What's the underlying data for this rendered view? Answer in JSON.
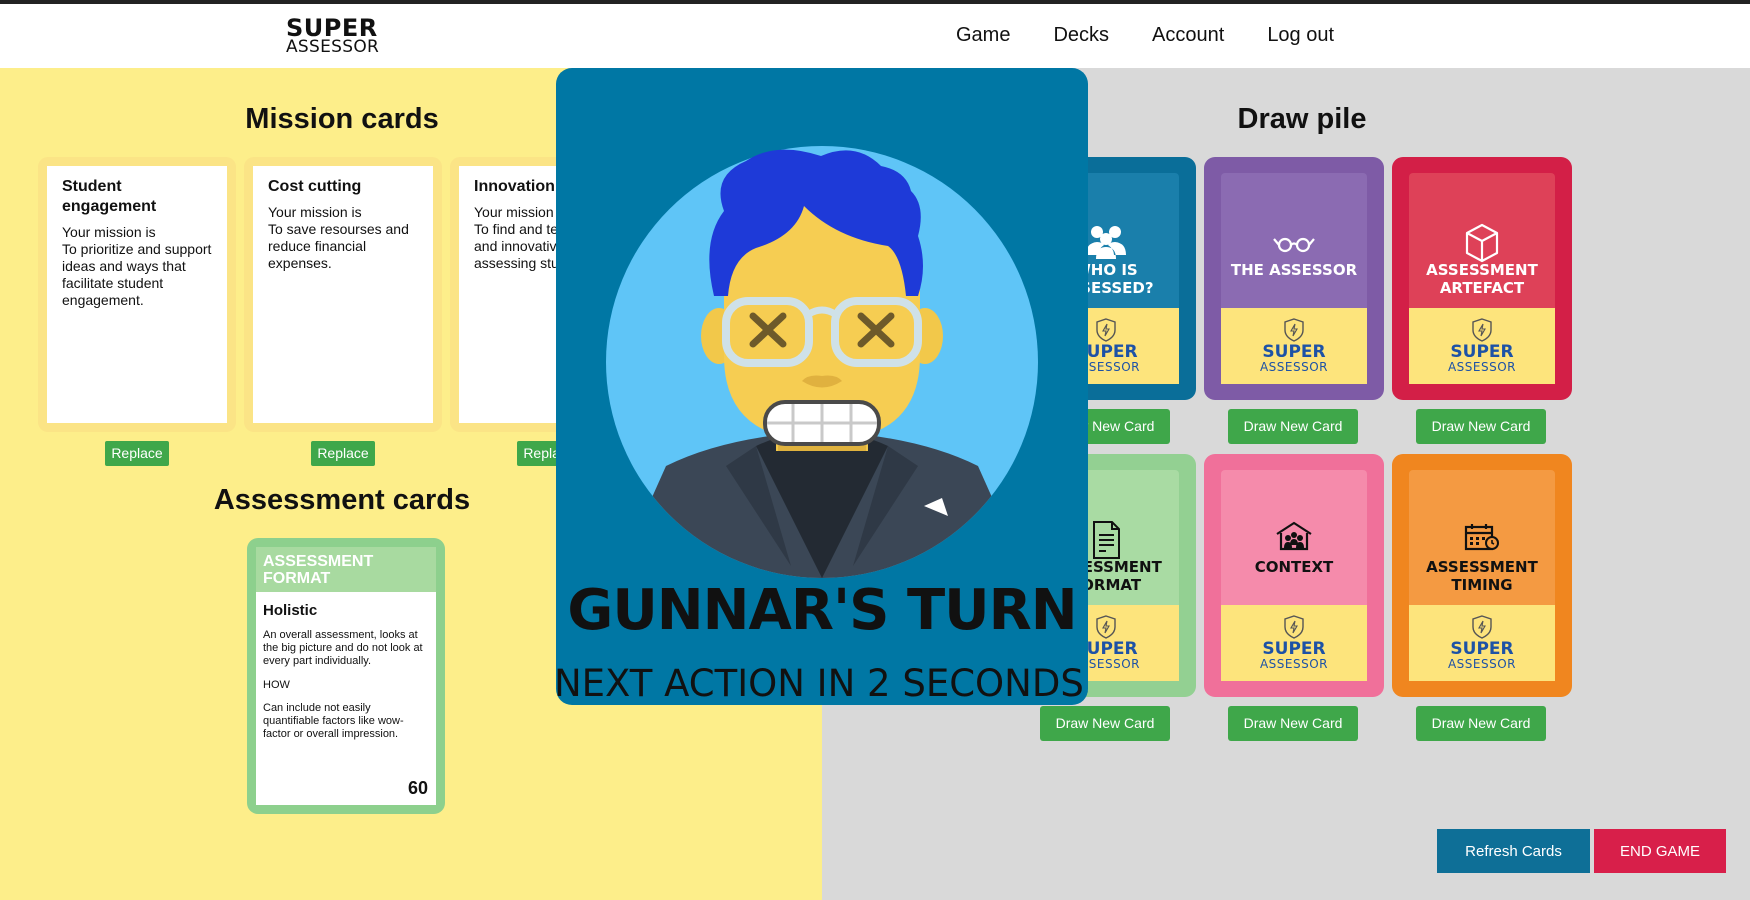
{
  "header": {
    "logo_line1": "SUPER",
    "logo_line2": "ASSESSOR",
    "nav": [
      "Game",
      "Decks",
      "Account",
      "Log out"
    ]
  },
  "mission": {
    "title": "Mission cards",
    "cards": [
      {
        "title": "Student engagement",
        "text": "Your mission is\nTo prioritize and support ideas and ways that facilitate student engagement."
      },
      {
        "title": "Cost cutting",
        "text": "Your mission is\nTo save resourses and reduce financial expenses."
      },
      {
        "title": "Innovation",
        "text": "Your mission is\nTo find and test new and innovative ways of assessing students."
      }
    ],
    "replace_label": "Replace"
  },
  "assessment": {
    "title": "Assessment cards",
    "card": {
      "category": "ASSESSMENT FORMAT",
      "title": "Holistic",
      "description": "An overall assessment, looks at the big picture and do not look at every part individually.",
      "how": "HOW",
      "note": "Can include not easily quantifiable factors like wow-factor or overall impression.",
      "points": "60"
    }
  },
  "draw_pile": {
    "title": "Draw pile",
    "draw_label": "Draw New Card",
    "brand_line1": "SUPER",
    "brand_line2": "ASSESSOR",
    "decks": [
      {
        "title": "WHO IS ASSESSED?",
        "icon": "group-icon",
        "outer": "#0a6e99",
        "inner": "#1a7fab",
        "text_color": "#ffffff"
      },
      {
        "title": "THE ASSESSOR",
        "icon": "glasses-icon",
        "outer": "#7e5ba6",
        "inner": "#8b6bb2",
        "text_color": "#ffffff"
      },
      {
        "title": "ASSESSMENT ARTEFACT",
        "icon": "box-icon",
        "outer": "#d31f47",
        "inner": "#de4158",
        "text_color": "#ffffff"
      },
      {
        "title": "ASSESSMENT FORMAT",
        "icon": "document-icon",
        "outer": "#93d092",
        "inner": "#a9dba3",
        "text_color": "#111111"
      },
      {
        "title": "CONTEXT",
        "icon": "school-icon",
        "outer": "#f0709a",
        "inner": "#f58bab",
        "text_color": "#111111"
      },
      {
        "title": "ASSESSMENT TIMING",
        "icon": "calendar-icon",
        "outer": "#f0861f",
        "inner": "#f49a42",
        "text_color": "#111111"
      }
    ]
  },
  "actions": {
    "refresh": "Refresh Cards",
    "end_game": "END GAME"
  },
  "modal": {
    "turn_text": "GUNNAR'S TURN",
    "countdown": "NEXT ACTION IN 2 SECONDS..."
  }
}
